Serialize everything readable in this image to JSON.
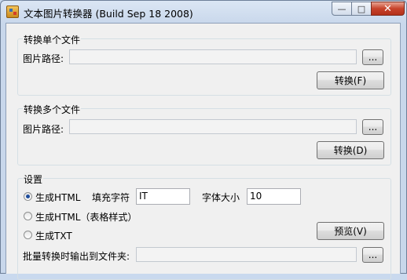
{
  "window": {
    "title": "文本图片转换器 (Build Sep 18 2008)",
    "controls": {
      "minimize": "—",
      "maximize": "□",
      "close": "✕"
    }
  },
  "single": {
    "group_label": "转换单个文件",
    "path_label": "图片路径:",
    "browse": "...",
    "convert": "转换(F)"
  },
  "multi": {
    "group_label": "转换多个文件",
    "path_label": "图片路径:",
    "browse": "...",
    "convert": "转换(D)"
  },
  "settings": {
    "group_label": "设置",
    "radio_html": "生成HTML",
    "radio_html_table": "生成HTML（表格样式）",
    "radio_txt": "生成TXT",
    "fill_label": "填充字符",
    "fill_value": "IT",
    "size_label": "字体大小",
    "size_value": "10",
    "preview": "预览(V)",
    "output_label": "批量转换时输出到文件夹:",
    "browse": "..."
  }
}
